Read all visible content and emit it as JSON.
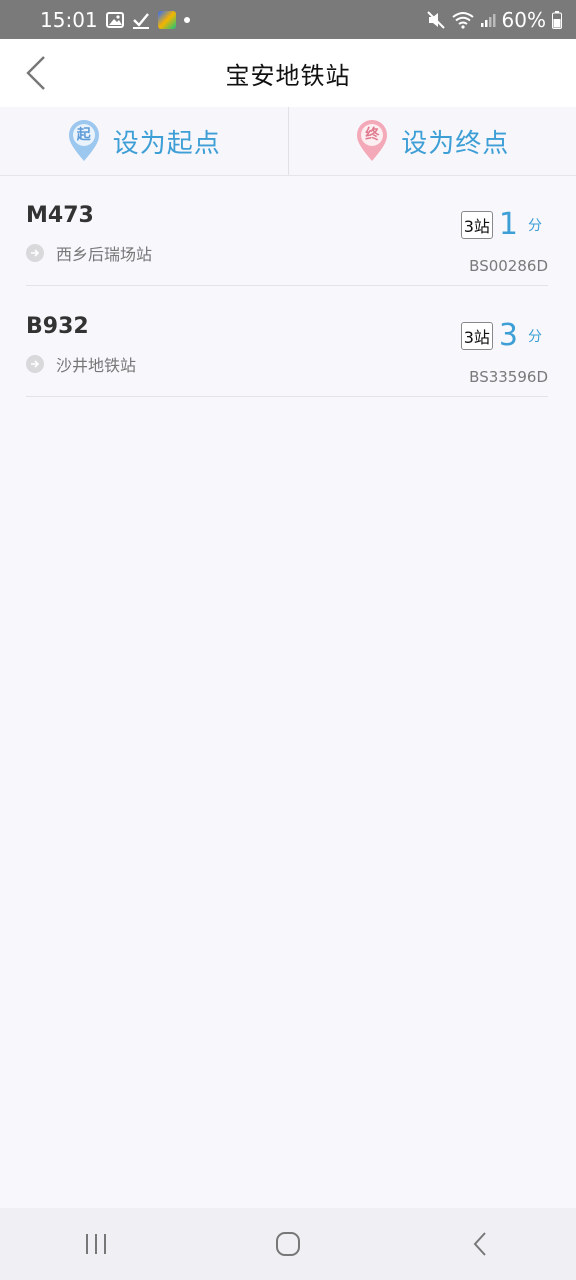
{
  "status_bar": {
    "time": "15:01",
    "battery": "60%"
  },
  "header": {
    "title": "宝安地铁站",
    "back_icon": "chevron-left-icon"
  },
  "actions": {
    "start_label": "设为起点",
    "start_pin": "起",
    "end_label": "设为终点",
    "end_pin": "终"
  },
  "routes": [
    {
      "name": "M473",
      "destination": "西乡后瑞场站",
      "stops": "3站",
      "eta": "1",
      "eta_unit": "分",
      "code": "BS00286D"
    },
    {
      "name": "B932",
      "destination": "沙井地铁站",
      "stops": "3站",
      "eta": "3",
      "eta_unit": "分",
      "code": "BS33596D"
    }
  ],
  "colors": {
    "accent": "#3d9fd6",
    "start_pin": "#9cc7ef",
    "end_pin": "#f4a9b8"
  }
}
